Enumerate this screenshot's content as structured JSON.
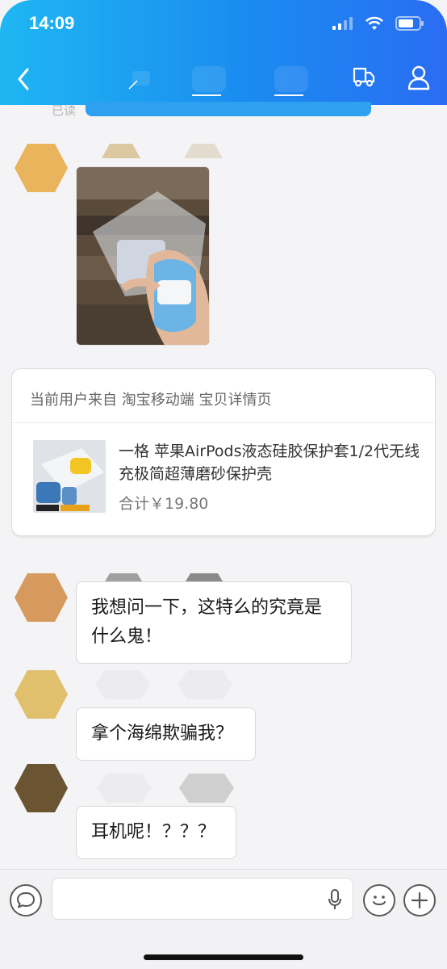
{
  "status_bar": {
    "time": "14:09"
  },
  "chat": {
    "read_label": "已读",
    "product_card": {
      "source_text": "当前用户来自 淘宝移动端 宝贝详情页",
      "title": "一格 苹果AirPods液态硅胶保护套1/2代无线充极简超薄磨砂保护壳",
      "price": "合计￥19.80"
    },
    "messages": [
      {
        "text": "我想问一下，这特么的究竟是什么鬼！"
      },
      {
        "text": "拿个海绵欺骗我？"
      },
      {
        "text": "耳机呢！？？？"
      }
    ]
  },
  "colors": {
    "header_start": "#1fb6f2",
    "header_end": "#2a6cf3",
    "avatar_1": "#e9b45c",
    "avatar_2": "#d69a5f",
    "avatar_3": "#e0c06c",
    "avatar_4": "#6a5431"
  },
  "icons": {
    "back": "chevron-left-icon",
    "shop": "truck-icon",
    "profile": "person-icon",
    "voice": "speech-bubble-icon",
    "mic": "microphone-icon",
    "emoji": "smiley-icon",
    "more": "plus-icon"
  }
}
